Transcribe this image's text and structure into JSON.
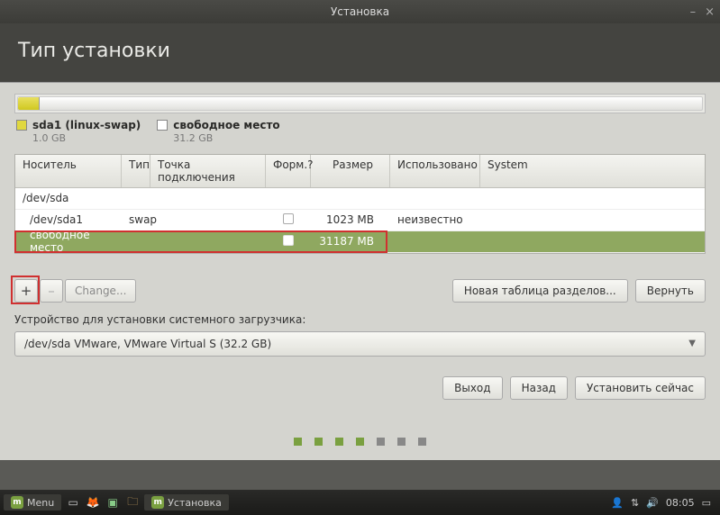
{
  "window": {
    "title": "Установка"
  },
  "header": {
    "title": "Тип установки"
  },
  "legend": [
    {
      "name": "sda1 (linux-swap)",
      "size": "1.0 GB",
      "swatch": "yellow"
    },
    {
      "name": "свободное место",
      "size": "31.2 GB",
      "swatch": "white"
    }
  ],
  "table": {
    "headers": {
      "device": "Носитель",
      "type": "Тип",
      "mount": "Точка подключения",
      "format": "Форм.?",
      "size": "Размер",
      "used": "Использовано",
      "system": "System"
    },
    "rows": [
      {
        "device": "/dev/sda",
        "type": "",
        "mount": "",
        "format": null,
        "size": "",
        "used": "",
        "indent": false
      },
      {
        "device": "/dev/sda1",
        "type": "swap",
        "mount": "",
        "format": false,
        "size": "1023 MB",
        "used": "неизвестно",
        "indent": true
      },
      {
        "device": "свободное место",
        "type": "",
        "mount": "",
        "format": false,
        "size": "31187 MB",
        "used": "",
        "indent": true,
        "selected": true
      }
    ]
  },
  "toolbar": {
    "add": "+",
    "remove": "–",
    "change": "Change...",
    "new_table": "Новая таблица разделов...",
    "revert": "Вернуть"
  },
  "bootloader": {
    "label": "Устройство для установки системного загрузчика:",
    "value": "/dev/sda VMware, VMware Virtual S (32.2 GB)"
  },
  "nav": {
    "quit": "Выход",
    "back": "Назад",
    "install": "Установить сейчас"
  },
  "taskbar": {
    "menu": "Menu",
    "task": "Установка",
    "time": "08:05"
  }
}
